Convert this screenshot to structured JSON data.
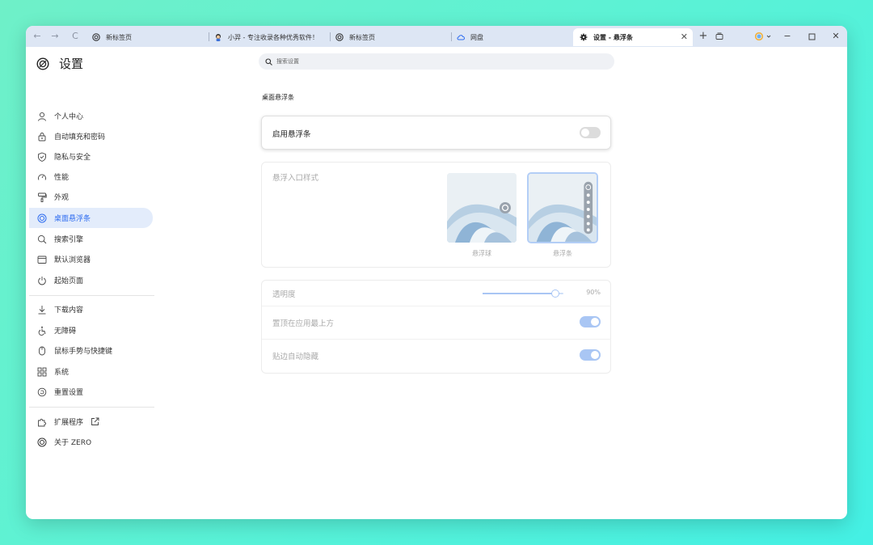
{
  "tabs": [
    {
      "label": "新标签页",
      "icon": "zero-logo-icon"
    },
    {
      "label": "小羿 - 专注收录各种优秀软件！",
      "icon": "avatar-icon"
    },
    {
      "label": "新标签页",
      "icon": "zero-logo-icon"
    },
    {
      "label": "网盘",
      "icon": "cloud-icon"
    },
    {
      "label": "设置 - 悬浮条",
      "icon": "gear-icon",
      "active": true
    }
  ],
  "sidebar": {
    "title": "设置",
    "items": [
      {
        "label": "个人中心",
        "icon": "person-icon"
      },
      {
        "label": "自动填充和密码",
        "icon": "lock-icon"
      },
      {
        "label": "隐私与安全",
        "icon": "shield-icon"
      },
      {
        "label": "性能",
        "icon": "gauge-icon"
      },
      {
        "label": "外观",
        "icon": "paint-roller-icon"
      },
      {
        "label": "桌面悬浮条",
        "icon": "zero-logo-icon",
        "active": true
      },
      {
        "label": "搜索引擎",
        "icon": "search-icon"
      },
      {
        "label": "默认浏览器",
        "icon": "browser-icon"
      },
      {
        "label": "起始页面",
        "icon": "power-icon"
      },
      {
        "label": "下载内容",
        "icon": "download-icon"
      },
      {
        "label": "无障碍",
        "icon": "accessibility-icon"
      },
      {
        "label": "鼠标手势与快捷键",
        "icon": "mouse-icon"
      },
      {
        "label": "系统",
        "icon": "grid-icon"
      },
      {
        "label": "重置设置",
        "icon": "reset-icon"
      },
      {
        "label": "扩展程序",
        "icon": "puzzle-icon"
      },
      {
        "label": "关于 ZERO",
        "icon": "zero-logo-icon"
      }
    ]
  },
  "search": {
    "placeholder": "搜索设置"
  },
  "main": {
    "section_title": "桌面悬浮条",
    "enable_label": "启用悬浮条",
    "enable_on": false,
    "style_label": "悬浮入口样式",
    "style_options": [
      {
        "label": "悬浮球",
        "selected": false
      },
      {
        "label": "悬浮条",
        "selected": true
      }
    ],
    "opacity_label": "透明度",
    "opacity_value": "90%",
    "opacity_fraction": 0.9,
    "on_top_label": "置顶在应用最上方",
    "on_top_on": true,
    "auto_hide_label": "贴边自动隐藏",
    "auto_hide_on": true
  },
  "colors": {
    "accent": "#2f6df0",
    "toggle_on_disabled": "#a9c6f4",
    "toggle_off": "#dcdcdc",
    "disabled_text": "#aaaaaa"
  }
}
